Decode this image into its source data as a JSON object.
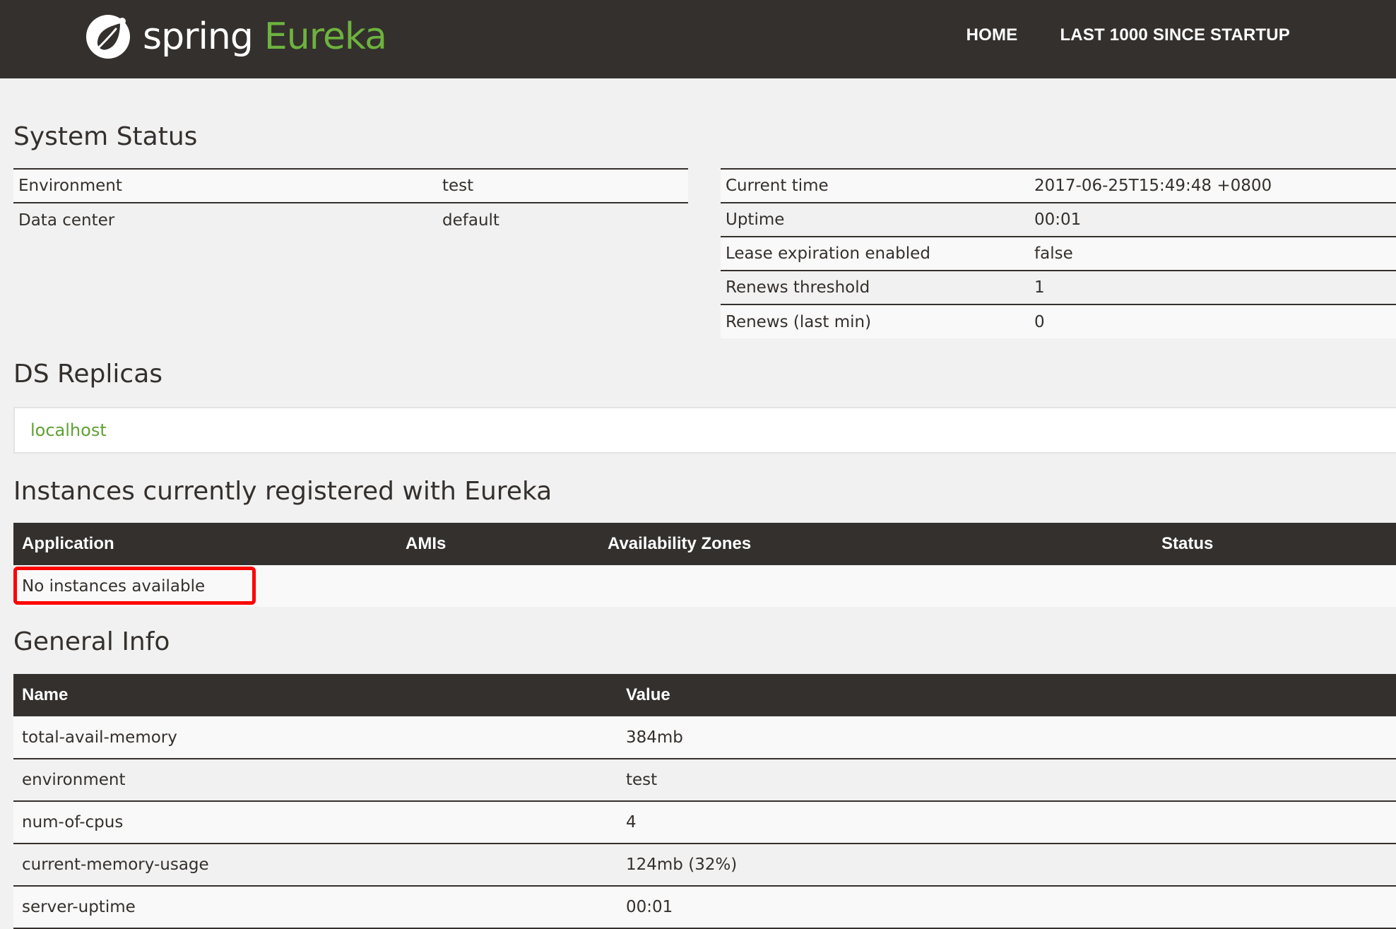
{
  "brand": {
    "logo_icon": "spring-leaf-icon",
    "spring_text": "spring",
    "eureka_text": "Eureka",
    "accent_color": "#6db33f"
  },
  "nav": {
    "home_label": "HOME",
    "last_label": "LAST 1000 SINCE STARTUP"
  },
  "system_status": {
    "title": "System Status",
    "left": [
      {
        "label": "Environment",
        "value": "test"
      },
      {
        "label": "Data center",
        "value": "default"
      }
    ],
    "right": [
      {
        "label": "Current time",
        "value": "2017-06-25T15:49:48 +0800"
      },
      {
        "label": "Uptime",
        "value": "00:01"
      },
      {
        "label": "Lease expiration enabled",
        "value": "false"
      },
      {
        "label": "Renews threshold",
        "value": "1"
      },
      {
        "label": "Renews (last min)",
        "value": "0"
      }
    ]
  },
  "replicas": {
    "title": "DS Replicas",
    "items": [
      "localhost"
    ]
  },
  "instances": {
    "title": "Instances currently registered with Eureka",
    "columns": [
      "Application",
      "AMIs",
      "Availability Zones",
      "Status"
    ],
    "empty_message": "No instances available"
  },
  "general_info": {
    "title": "General Info",
    "columns": [
      "Name",
      "Value"
    ],
    "rows": [
      {
        "name": "total-avail-memory",
        "value": "384mb"
      },
      {
        "name": "environment",
        "value": "test"
      },
      {
        "name": "num-of-cpus",
        "value": "4"
      },
      {
        "name": "current-memory-usage",
        "value": "124mb (32%)"
      },
      {
        "name": "server-uptime",
        "value": "00:01"
      }
    ]
  }
}
